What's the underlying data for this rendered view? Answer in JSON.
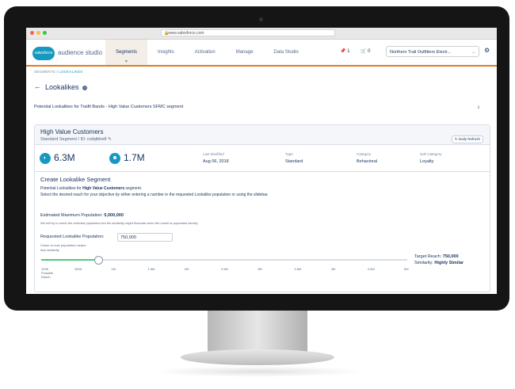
{
  "browser": {
    "url": "www.salesforce.com",
    "dot_colors": [
      "#fc605b",
      "#fdbc40",
      "#34c84a"
    ]
  },
  "nav": {
    "logo": "salesforce",
    "product": "audience studio",
    "tabs": [
      "Segments",
      "Insights",
      "Activation",
      "Manage",
      "Data Studio"
    ],
    "active_tab": "Segments",
    "pin_count": "1",
    "cart_count": "0",
    "account": "Northern Trail Outfitters Electr..."
  },
  "breadcrumb": {
    "root": "SEGMENTS",
    "sep": " / ",
    "current": "LOOKALIKES"
  },
  "page": {
    "title": "Lookalikes",
    "potential_line": "Potential Lookalikes for Traifit Bands - High Value Customers SFMC segment"
  },
  "segment": {
    "name": "High Value Customers",
    "sub": "Standard Segment / ID: rsdqtbhe8",
    "refresh": "Daily Refresh",
    "stat1": "6.3M",
    "stat2": "1.7M",
    "meta": [
      {
        "label": "Last Modified",
        "value": "Aug 06, 2018"
      },
      {
        "label": "Type",
        "value": "Standard"
      },
      {
        "label": "Category",
        "value": "Behavioral"
      },
      {
        "label": "Sub Category",
        "value": "Loyalty"
      }
    ]
  },
  "create": {
    "title": "Create Lookalike Segment",
    "line1_pre": "Potential Lookalikes for ",
    "line1_bold": "High Value Customers",
    "line1_post": " segment.",
    "line2": "Select the desired reach for your objective by either entering a number in the requested Lookalike population or using the slidebar.",
    "est_label": "Estimated Maximum Population: ",
    "est_value": "5,000,000",
    "est_note": "We will try to reach the selected population but the similarity might fluctuate when the model is populated weekly",
    "req_label": "Requested Lookalike Population:",
    "req_value": "750,000",
    "close_label": "Closer to max population means",
    "less_label": "less similarity",
    "slider_fraction": 0.155,
    "target_label": "Target Reach: ",
    "target_value": "750,000",
    "sim_label": "Similarity: ",
    "sim_value": "Highly Similar",
    "ticks": [
      "100K",
      "500K",
      "1M",
      "1.5M",
      "2M",
      "2.5M",
      "3M",
      "3.5M",
      "4M",
      "4.5M",
      "5M"
    ],
    "possible": "Possible",
    "reach": "Reach"
  },
  "colors": {
    "accent": "#1798c1",
    "nav_border": "#e27a1f",
    "slider_fill": "#4bca81"
  }
}
